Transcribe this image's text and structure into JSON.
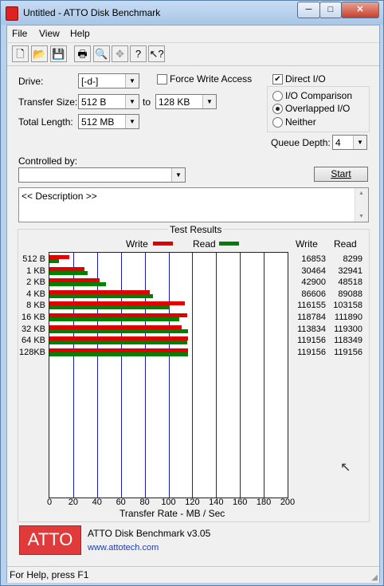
{
  "window": {
    "title": "Untitled - ATTO Disk Benchmark"
  },
  "menu": [
    "File",
    "View",
    "Help"
  ],
  "toolbar": {
    "icons": [
      "new-document-icon",
      "open-folder-icon",
      "save-icon",
      "print-icon",
      "print-preview-icon",
      "move-icon",
      "help-icon",
      "context-help-icon"
    ]
  },
  "form": {
    "drive_label": "Drive:",
    "drive_value": "[-d-]",
    "force_write_label": "Force Write Access",
    "direct_io_label": "Direct I/O",
    "transfer_size_label": "Transfer Size:",
    "transfer_from": "512 B",
    "to_label": "to",
    "transfer_to": "128 KB",
    "total_length_label": "Total Length:",
    "total_length": "512 MB",
    "io_options": [
      "I/O Comparison",
      "Overlapped I/O",
      "Neither"
    ],
    "queue_depth_label": "Queue Depth:",
    "queue_depth": "4",
    "controlled_by_label": "Controlled by:",
    "controlled_by": "",
    "start_label": "Start",
    "description": "<< Description >>"
  },
  "results": {
    "title": "Test Results",
    "write_legend": "Write",
    "read_legend": "Read",
    "write_col": "Write",
    "read_col": "Read",
    "write_color": "#e00000",
    "read_color": "#008000"
  },
  "chart_data": {
    "type": "bar",
    "title": "Test Results",
    "xlabel": "Transfer Rate - MB / Sec",
    "xlim": [
      0,
      200
    ],
    "xticks": [
      "0",
      "20",
      "40",
      "60",
      "80",
      "100",
      "120",
      "140",
      "160",
      "180",
      "200"
    ],
    "categories": [
      "512 B",
      "1 KB",
      "2 KB",
      "4 KB",
      "8 KB",
      "16 KB",
      "32 KB",
      "64 KB",
      "128KB"
    ],
    "series": [
      {
        "name": "Write",
        "values": [
          16853,
          30464,
          42900,
          86606,
          116155,
          118784,
          113834,
          119156,
          119156
        ]
      },
      {
        "name": "Read",
        "values": [
          8299,
          32941,
          48518,
          89088,
          103158,
          111890,
          119300,
          118349,
          119156
        ]
      }
    ]
  },
  "logo": {
    "text": "ATTO",
    "product": "ATTO Disk Benchmark v3.05",
    "url": "www.attotech.com"
  },
  "status": "For Help, press F1"
}
